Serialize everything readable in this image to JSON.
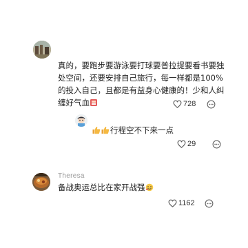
{
  "comments": [
    {
      "username": "",
      "text": "真的，要跑步要游泳要打球要普拉提要看书要独处空间，还要安排自己旅行，每一样都是100%的投入自己，且都是有益身心健康的！少和人纠缠好气血",
      "likes": "728",
      "avatar": "landscape-photo-avatar"
    },
    {
      "username": "",
      "text": "行程空不下来一点",
      "likes": "29",
      "avatar": "cartoon-avatar",
      "leading_icons": [
        "thumbs-up-icon",
        "thumbs-up-icon"
      ]
    },
    {
      "username": "Theresa",
      "text": "备战奥运总比在家开战强",
      "likes": "1162",
      "avatar": "food-photo-avatar"
    }
  ],
  "icons": {
    "like": "heart-outline-icon",
    "more": "more-options-icon"
  },
  "colors": {
    "text": "#1f1f1f",
    "meta": "#9a9a9a",
    "icon": "#555555"
  }
}
